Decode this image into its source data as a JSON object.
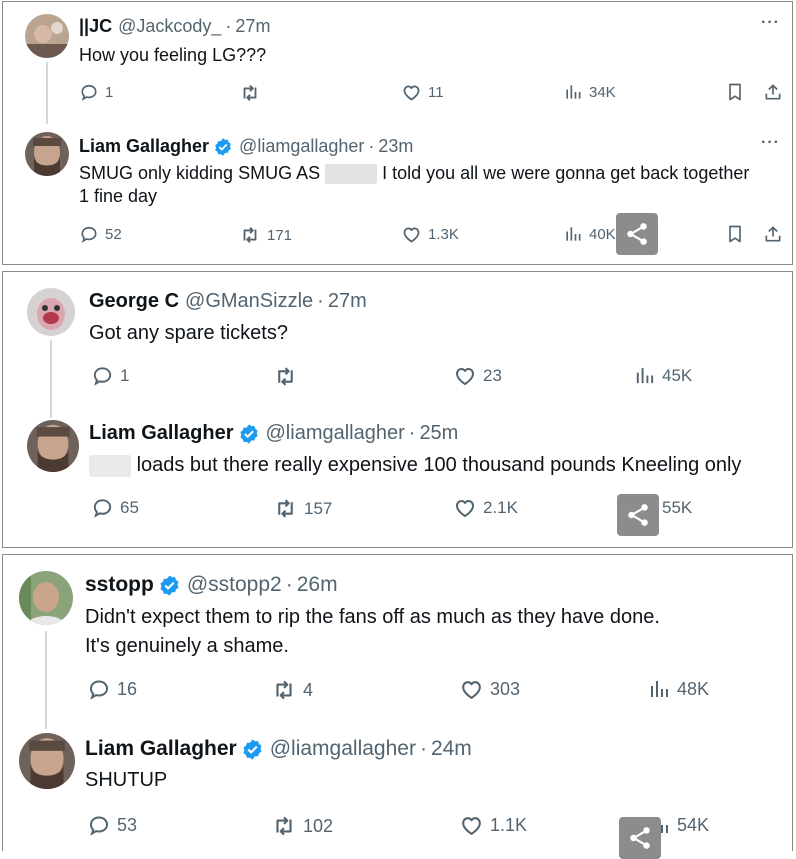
{
  "panels": [
    {
      "reply": {
        "name": "||JC",
        "handle": "@Jackcody_",
        "time": "27m",
        "text": "How you feeling LG???",
        "replies": "1",
        "retweets": "",
        "likes": "11",
        "views": "34K"
      },
      "answer": {
        "name": "Liam Gallagher",
        "handle": "@liamgallagher",
        "time": "23m",
        "text_before": "SMUG only kidding SMUG AS",
        "text_after": "I told you all we were gonna get back together",
        "text_line2": "1 fine day",
        "replies": "52",
        "retweets": "171",
        "likes": "1.3K",
        "views": "40K"
      }
    },
    {
      "reply": {
        "name": "George C",
        "handle": "@GManSizzle",
        "time": "27m",
        "text": "Got any spare tickets?",
        "replies": "1",
        "retweets": "",
        "likes": "23",
        "views": "45K"
      },
      "answer": {
        "name": "Liam Gallagher",
        "handle": "@liamgallagher",
        "time": "25m",
        "text_after": "loads but there really expensive 100 thousand pounds Kneeling only",
        "replies": "65",
        "retweets": "157",
        "likes": "2.1K",
        "views": "55K"
      }
    },
    {
      "reply": {
        "name": "sstopp",
        "handle": "@sstopp2",
        "time": "26m",
        "text_line1": "Didn't expect them to rip the fans off as much as they have done.",
        "text_line2": "It's genuinely a shame.",
        "replies": "16",
        "retweets": "4",
        "likes": "303",
        "views": "48K"
      },
      "answer": {
        "name": "Liam Gallagher",
        "handle": "@liamgallagher",
        "time": "24m",
        "text": "SHUTUP",
        "replies": "53",
        "retweets": "102",
        "likes": "1.1K",
        "views": "54K"
      }
    }
  ],
  "separator": "·",
  "more_label": "···",
  "colors": {
    "verified": "#1d9bf0",
    "muted": "#536471",
    "text": "#0f1419"
  },
  "icons": [
    "reply-icon",
    "retweet-icon",
    "like-icon",
    "views-icon",
    "bookmark-icon",
    "share-icon",
    "verified-icon",
    "more-icon"
  ]
}
